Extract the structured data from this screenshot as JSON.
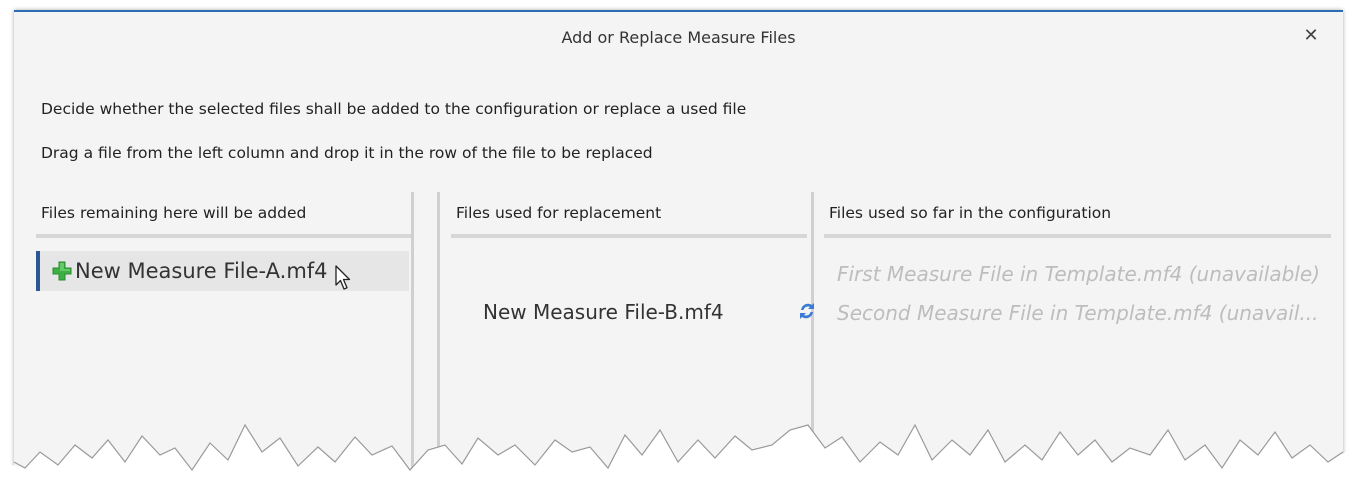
{
  "dialog": {
    "title": "Add or Replace Measure Files",
    "close_glyph": "✕",
    "description_line1": "Decide whether the selected files shall be added to the configuration or replace a used file",
    "description_line2": "Drag a file from the left column and drop it in the row of the file to be replaced"
  },
  "columns": {
    "added": {
      "header": "Files remaining here will be added",
      "items": [
        {
          "label": "New Measure File-A.mf4",
          "icon": "plus-icon",
          "icon_color": "#3cb043"
        }
      ]
    },
    "replacement": {
      "header": "Files used for replacement",
      "items": [
        {
          "label": "New Measure File-B.mf4",
          "icon": "swap-icon",
          "icon_color": "#3a7bd5"
        }
      ]
    },
    "configuration": {
      "header": "Files used so far in the configuration",
      "items": [
        {
          "label": "First Measure File in Template.mf4 (unavailable)"
        },
        {
          "label": "Second Measure File in Template.mf4 (unavail..."
        }
      ]
    }
  },
  "colors": {
    "accent": "#2e6db4",
    "selection_bar": "#2b5797",
    "unavailable_text": "#bdbdbd"
  }
}
